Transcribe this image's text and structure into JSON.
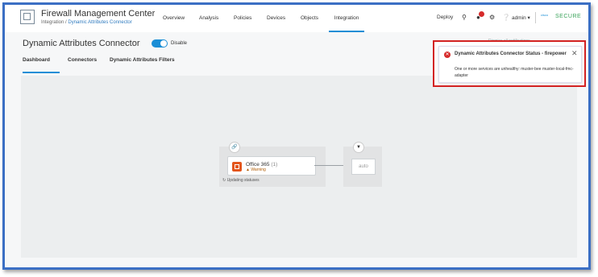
{
  "header": {
    "app_title": "Firewall Management Center",
    "breadcrumb_parent": "Integration",
    "breadcrumb_sep": " / ",
    "breadcrumb_current": "Dynamic Attributes Connector"
  },
  "nav": {
    "items": [
      "Overview",
      "Analysis",
      "Policies",
      "Devices",
      "Objects",
      "Integration"
    ],
    "active": "Integration"
  },
  "user": {
    "deploy": "Deploy",
    "admin": "admin",
    "cisco": "cisco",
    "secure": "SECURE"
  },
  "page": {
    "title": "Dynamic Attributes Connector",
    "toggle_label": "Disable",
    "tabs": [
      "Dashboard",
      "Connectors",
      "Dynamic Attributes Filters"
    ],
    "active_tab": "Dashboard"
  },
  "diagram": {
    "connector_name": "Office 365",
    "connector_count": "(1)",
    "connector_status": "Warning",
    "updating_text": "Updating statuses",
    "filter_label": "auto"
  },
  "toast": {
    "title": "Dynamic Attributes Connector Status - firepower",
    "message": "One or more services are unhealthy: muster-bee muster-local-fmc-adapter",
    "hint": "Dismiss all notifications"
  },
  "colors": {
    "accent": "#1a8ed6",
    "error": "#d62b2b",
    "highlight_border": "#d32222",
    "frame_border": "#3b6fc4",
    "office_orange": "#e3561c",
    "secure_green": "#3aa35a"
  },
  "icons": [
    "firewall-logo-icon",
    "search-icon",
    "notifications-icon",
    "gear-icon",
    "help-icon",
    "link-icon",
    "filter-icon",
    "office365-icon",
    "warning-icon",
    "error-icon",
    "close-icon"
  ]
}
